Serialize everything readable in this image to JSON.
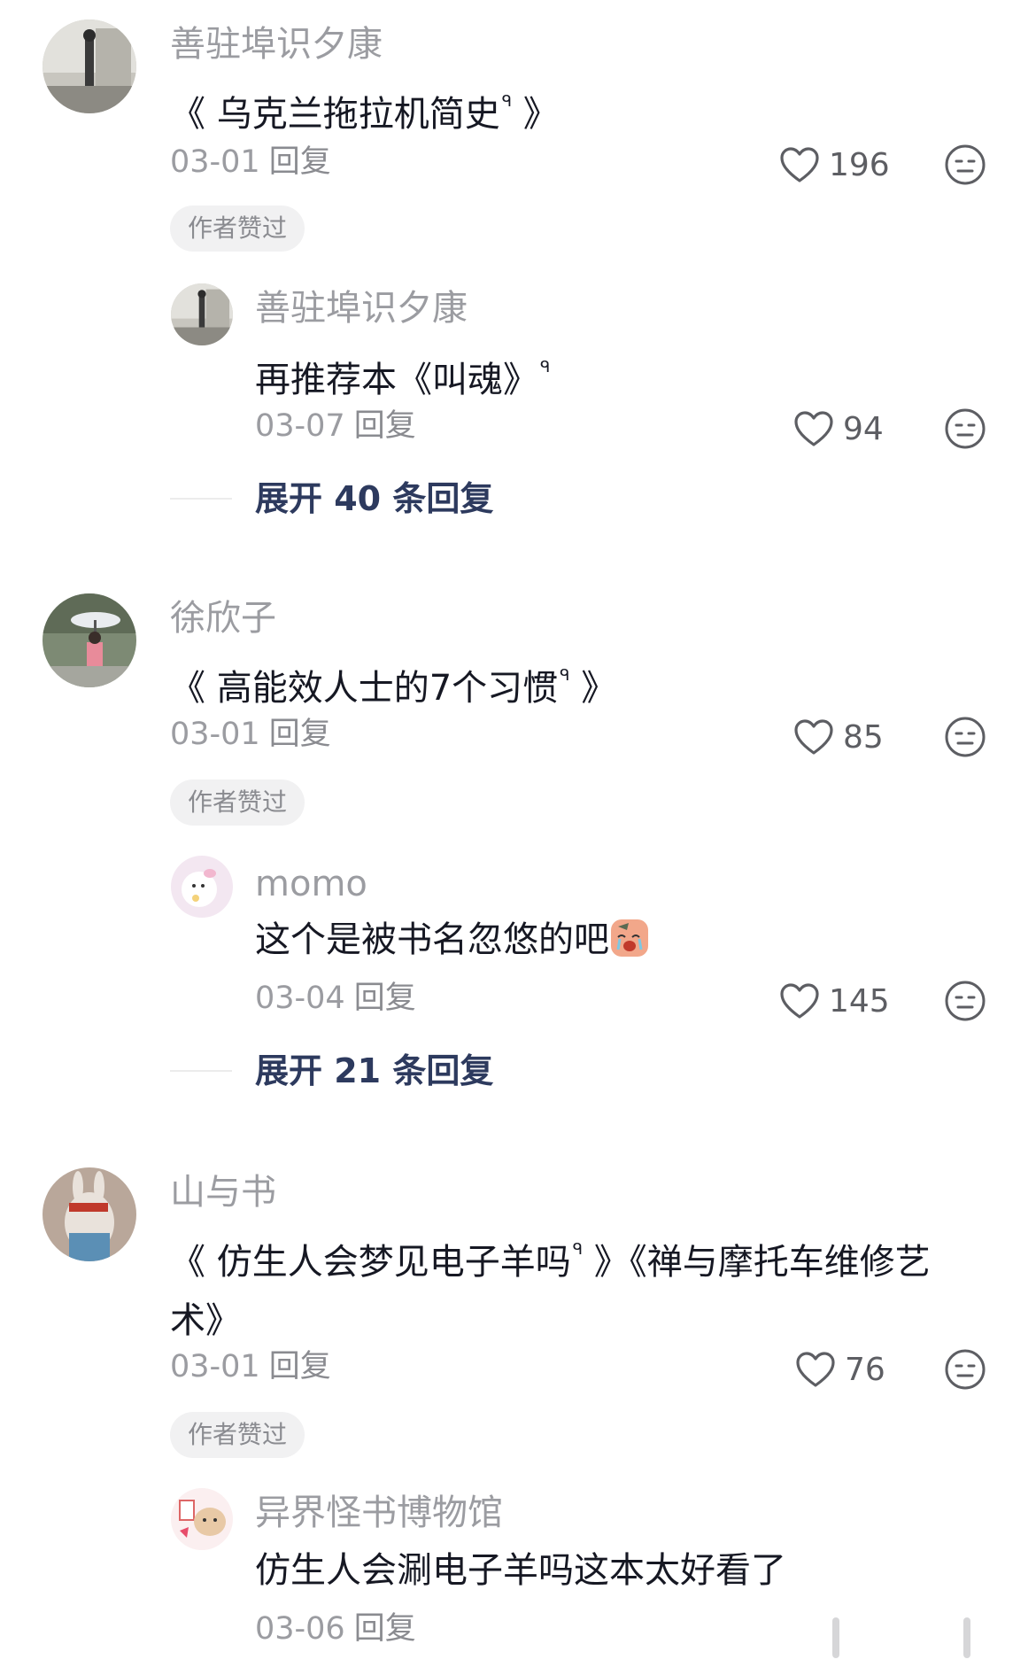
{
  "comments": [
    {
      "username": "善驻埠识夕康",
      "content": "《 乌克兰拖拉机简史",
      "content_tail": " 》",
      "date": "03-01",
      "reply_label": "回复",
      "likes": "196",
      "badge": "作者赞过",
      "sub_reply": {
        "username": "善驻埠识夕康",
        "content": "再推荐本《叫魂》",
        "date": "03-07",
        "reply_label": "回复",
        "likes": "94"
      },
      "expand_label": "展开 40 条回复"
    },
    {
      "username": "徐欣子",
      "content": "《 高能效人士的7个习惯",
      "content_tail": " 》",
      "date": "03-01",
      "reply_label": "回复",
      "likes": "85",
      "badge": "作者赞过",
      "sub_reply": {
        "username": "momo",
        "content": "这个是被书名忽悠的吧",
        "date": "03-04",
        "reply_label": "回复",
        "likes": "145"
      },
      "expand_label": "展开 21 条回复"
    },
    {
      "username": "山与书",
      "content_line1": "《 仿生人会梦见电子羊吗",
      "content_line1_tail": " 》《禅与摩托车维修艺",
      "content_line2": "术》",
      "date": "03-01",
      "reply_label": "回复",
      "likes": "76",
      "badge": "作者赞过",
      "sub_reply": {
        "username": "异界怪书博物馆",
        "content": "仿生人会涮电子羊吗这本太好看了",
        "date": "03-06",
        "reply_label": "回复"
      }
    }
  ],
  "search_marker": "ᑫ",
  "colors": {
    "name_gray": "#9b9ca1",
    "text_dark": "#161823",
    "expand_blue": "#2d3a5e",
    "badge_bg": "#f1f1f2"
  },
  "icons": [
    "heart-outline-icon",
    "dislike-face-icon",
    "search-marker-icon",
    "crying-face-emoji"
  ]
}
